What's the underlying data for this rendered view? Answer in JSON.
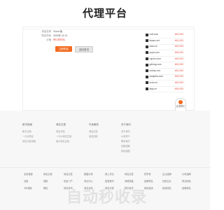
{
  "header": {
    "brand": "代理平台"
  },
  "product": {
    "fields": [
      {
        "label": "商品名称",
        "value": "Cloud 版"
      },
      {
        "label": "购买时间",
        "value": "2024年 21:21"
      },
      {
        "label": "价格",
        "value": "¥6,000元"
      }
    ],
    "buy_label": "立即购买",
    "back_label": "返回首页"
  },
  "domains": [
    {
      "name": "rcdt.com",
      "price": "¥40,000"
    },
    {
      "name": "ttwarz.net",
      "price": "¥40,000"
    },
    {
      "name": "zaso.cn",
      "price": "¥40,000"
    },
    {
      "name": "yuyd.com",
      "price": "¥40,000"
    },
    {
      "name": "rujohn.com",
      "price": "¥40,000"
    },
    {
      "name": "gdlong.com",
      "price": "¥40,000"
    },
    {
      "name": "nmkso.net",
      "price": "¥40,000"
    },
    {
      "name": "waqstha.com",
      "price": "¥40,000"
    },
    {
      "name": "kzuh.cn",
      "price": "¥40,000"
    },
    {
      "name": "abjs.cn",
      "price": "¥40,000"
    }
  ],
  "float_widget": {
    "label": "请求帮忙"
  },
  "footer": {
    "columns": [
      {
        "title": "新手指南",
        "links": [
          "新手注册",
          "一口价购买",
          "域名交易流程"
        ]
      },
      {
        "title": "域名交易",
        "links": [
          "域名评估",
          "一口价域名交易",
          "竞价域名交易"
        ]
      },
      {
        "title": "外卖服务",
        "links": [
          "域名出售",
          "域名回收"
        ]
      },
      {
        "title": "关于我们",
        "links": [
          "关于我们",
          "公司简介",
          "联系我们",
          "在职招聘",
          "网站地图"
        ]
      }
    ],
    "bottom_rows": [
      [
        "友情链接",
        "域名交易",
        "域名出售",
        "数据分析",
        "网上开店",
        "域名出售",
        "药学家",
        "企业品牌",
        "公司品牌"
      ],
      [
        "百度",
        "搜狗",
        "信息门户",
        "商业中心",
        "智慧城市",
        "商城快建",
        "品牌排名",
        "优质企业",
        "商业网站"
      ],
      [
        "360搜索",
        "微信",
        "域名资讯",
        "域名百科",
        "域名交易",
        "数字经济",
        "网站建设",
        "精选域名",
        "品牌域名"
      ]
    ],
    "watermark": "自动秒收录"
  }
}
